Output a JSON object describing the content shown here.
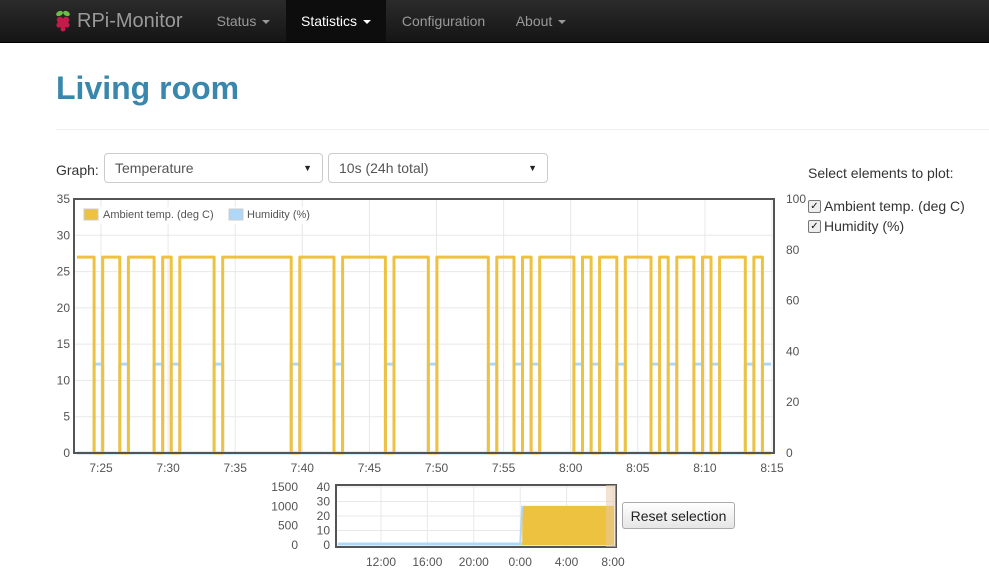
{
  "navbar": {
    "brand": "RPi-Monitor",
    "items": [
      {
        "label": "Status",
        "dropdown": true,
        "active": false
      },
      {
        "label": "Statistics",
        "dropdown": true,
        "active": true
      },
      {
        "label": "Configuration",
        "dropdown": false,
        "active": false
      },
      {
        "label": "About",
        "dropdown": true,
        "active": false
      }
    ]
  },
  "page": {
    "title": "Living room",
    "graph_label": "Graph:",
    "graph_select": "Temperature",
    "interval_select": "10s (24h total)",
    "select_title": "Select elements to plot:",
    "plot_options": [
      {
        "label": "Ambient temp. (deg C)",
        "checked": true
      },
      {
        "label": "Humidity (%)",
        "checked": true
      }
    ],
    "reset_button": "Reset selection"
  },
  "colors": {
    "temp": "#edc240",
    "humidity": "#afd8f8",
    "title": "#3a87ad"
  },
  "chart_data": [
    {
      "type": "line",
      "legend_position": "top-left",
      "x_ticks": [
        "7:25",
        "7:30",
        "7:35",
        "7:40",
        "7:45",
        "7:50",
        "7:55",
        "8:00",
        "8:05",
        "8:10",
        "8:15"
      ],
      "y_left_ticks": [
        "0",
        "5",
        "10",
        "15",
        "20",
        "25",
        "30",
        "35"
      ],
      "y_left_range": [
        0,
        35
      ],
      "y_right_ticks": [
        "0",
        "20",
        "40",
        "60",
        "80",
        "100"
      ],
      "y_right_range": [
        0,
        100
      ],
      "series": [
        {
          "name": "Ambient temp. (deg C)",
          "axis": "left",
          "high": 27,
          "low": 0,
          "pattern": [
            1,
            1,
            0,
            1,
            1,
            0,
            1,
            1,
            1,
            0,
            1,
            0,
            1,
            1,
            1,
            1,
            0,
            1,
            1,
            1,
            1,
            1,
            1,
            1,
            1,
            0,
            1,
            1,
            1,
            1,
            0,
            1,
            1,
            1,
            1,
            1,
            0,
            1,
            1,
            1,
            1,
            0,
            1,
            1,
            1,
            1,
            1,
            1,
            0,
            1,
            1,
            0,
            1,
            0,
            1,
            1,
            1,
            1,
            0,
            1,
            0,
            1,
            1,
            0,
            1,
            1,
            1,
            0,
            1,
            0,
            1,
            1,
            0,
            1,
            0,
            1,
            1,
            1,
            0,
            1,
            0
          ]
        },
        {
          "name": "Humidity (%)",
          "axis": "right",
          "high": 35,
          "low": 0,
          "pattern": [
            0,
            0,
            1,
            0,
            0,
            1,
            0,
            0,
            0,
            1,
            0,
            1,
            0,
            0,
            0,
            0,
            1,
            0,
            0,
            0,
            0,
            0,
            0,
            0,
            0,
            1,
            0,
            0,
            0,
            0,
            1,
            0,
            0,
            0,
            0,
            0,
            1,
            0,
            0,
            0,
            0,
            1,
            0,
            0,
            0,
            0,
            0,
            0,
            1,
            0,
            0,
            1,
            0,
            1,
            0,
            0,
            0,
            0,
            1,
            0,
            1,
            0,
            0,
            1,
            0,
            0,
            0,
            1,
            0,
            1,
            0,
            0,
            1,
            0,
            1,
            0,
            0,
            0,
            1,
            0,
            1
          ]
        }
      ]
    },
    {
      "type": "area",
      "x_ticks": [
        "12:00",
        "16:00",
        "20:00",
        "0:00",
        "4:00",
        "8:00"
      ],
      "y_left_ticks": [
        "0",
        "500",
        "1000",
        "1500"
      ],
      "y_left_range": [
        0,
        1500
      ],
      "y_right_ticks": [
        "0",
        "10",
        "20",
        "30",
        "40"
      ],
      "y_right_range": [
        0,
        40
      ],
      "series": [
        {
          "name": "Ambient temp. (deg C)",
          "start": "0:00",
          "value": 27
        },
        {
          "name": "Humidity (%)",
          "value": 0
        }
      ]
    }
  ]
}
